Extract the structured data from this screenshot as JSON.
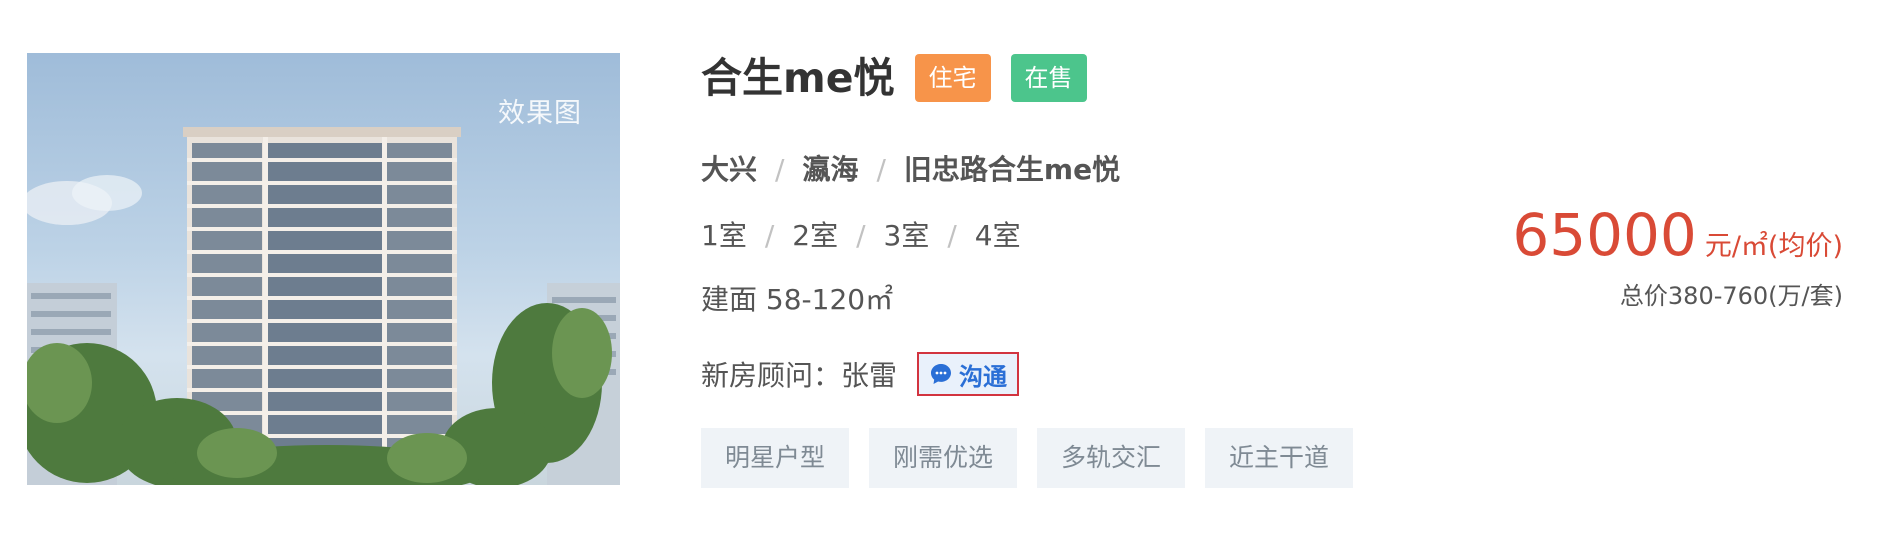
{
  "listing": {
    "image_tag": "效果图",
    "name": "合生me悦",
    "badge_type": "住宅",
    "badge_status": "在售",
    "location": {
      "district": "大兴",
      "area": "瀛海",
      "address": "旧忠路合生me悦"
    },
    "rooms": [
      "1室",
      "2室",
      "3室",
      "4室"
    ],
    "area_label": "建面 58-120㎡",
    "advisor_label": "新房顾问：",
    "advisor_name": "张雷",
    "chat_label": "沟通",
    "chat_icon": "chat-bubble-icon",
    "tags": [
      "明星户型",
      "刚需优选",
      "多轨交汇",
      "近主干道"
    ],
    "price": {
      "value": "65000",
      "unit": "元/㎡(均价)",
      "total": "总价380-760(万/套)"
    }
  },
  "colors": {
    "badge_type": "#f7944a",
    "badge_status": "#4cc58c",
    "price": "#d94a36",
    "chat_text": "#2a6fd6",
    "chat_border": "#d2343f",
    "tag_bg": "#eff3f7"
  }
}
